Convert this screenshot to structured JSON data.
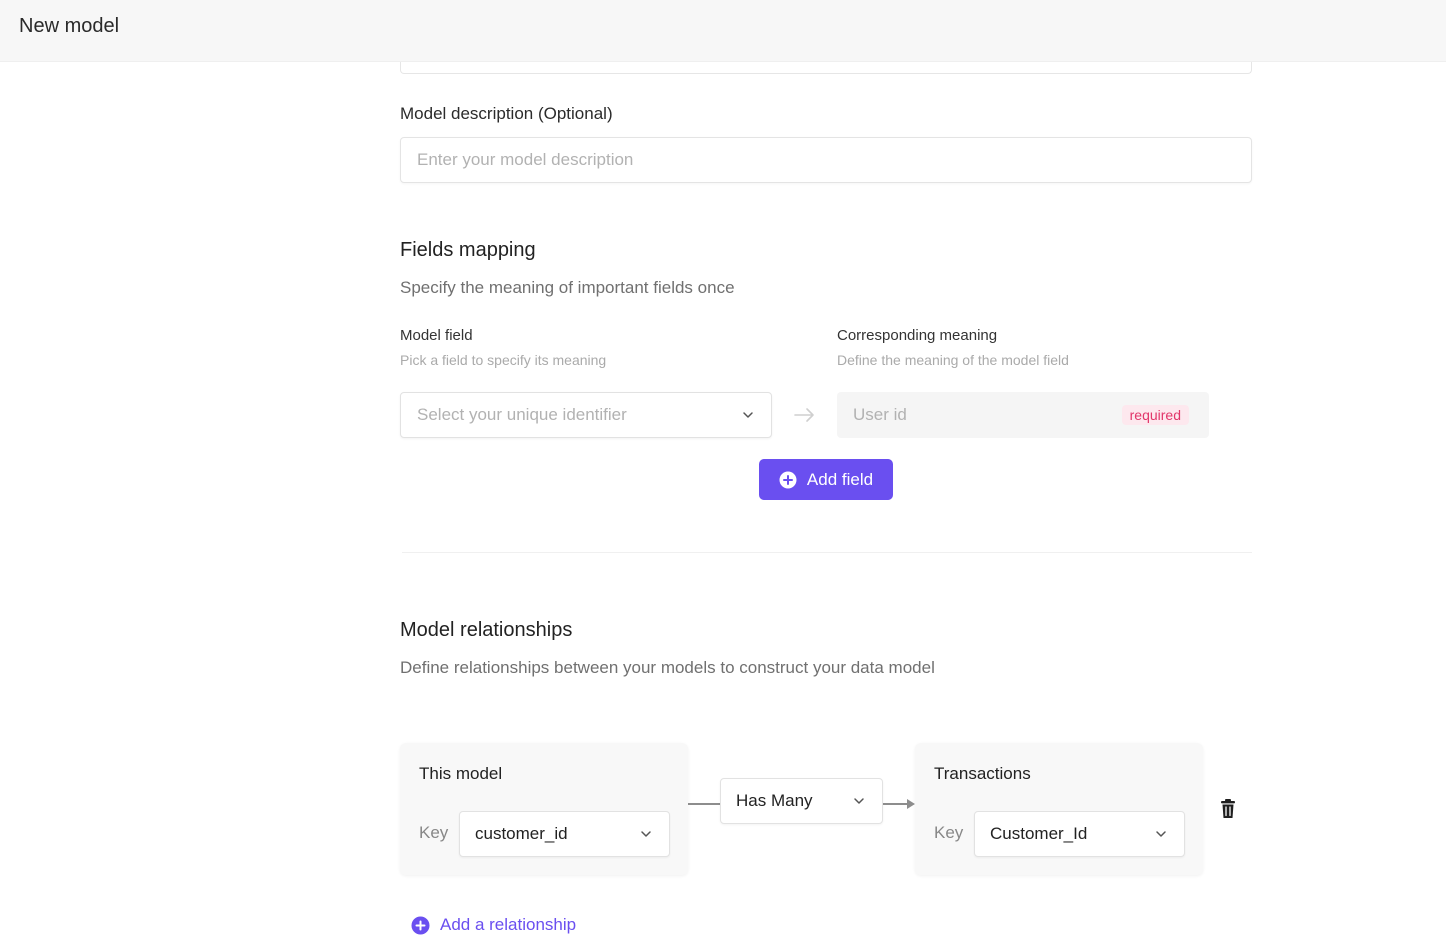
{
  "header": {
    "title": "New model"
  },
  "description": {
    "label": "Model description (Optional)",
    "placeholder": "Enter your model description"
  },
  "fields_mapping": {
    "title": "Fields mapping",
    "subtitle": "Specify the meaning of important fields once",
    "model_field": {
      "label": "Model field",
      "hint": "Pick a field to specify its meaning",
      "placeholder": "Select your unique identifier"
    },
    "meaning": {
      "label": "Corresponding meaning",
      "hint": "Define the meaning of the model field",
      "value": "User id",
      "badge": "required"
    },
    "add_button": "Add field"
  },
  "relationships": {
    "title": "Model relationships",
    "subtitle": "Define relationships between your models to construct your data model",
    "left": {
      "title": "This model",
      "key_label": "Key",
      "key_value": "customer_id"
    },
    "relation": "Has Many",
    "right": {
      "title": "Transactions",
      "key_label": "Key",
      "key_value": "Customer_Id"
    },
    "add_link": "Add a relationship"
  },
  "colors": {
    "accent": "#6a4ff0",
    "badge_text": "#e2366a",
    "badge_bg": "#fde8ee"
  },
  "icons": [
    "chevron-down-icon",
    "arrow-right-icon",
    "plus-circle-icon",
    "trash-icon"
  ]
}
